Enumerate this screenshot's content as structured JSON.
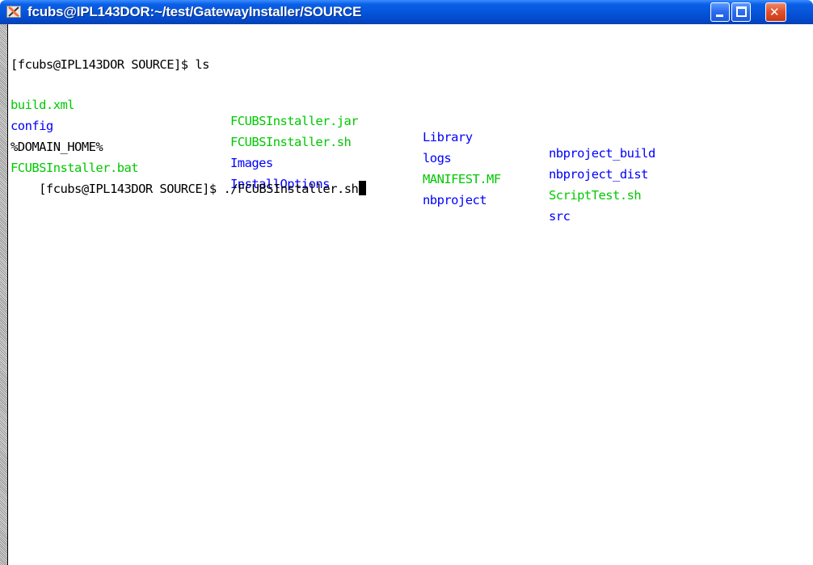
{
  "window": {
    "title": "fcubs@IPL143DOR:~/test/GatewayInstaller/SOURCE",
    "icons": {
      "app": "xterm-x-icon",
      "minimize": "minimize-icon",
      "maximize": "maximize-icon",
      "close": "close-icon"
    },
    "colors": {
      "titlebar": "#0554d8",
      "close": "#e0542e"
    }
  },
  "terminal": {
    "colors": {
      "text": "#000000",
      "file_green": "#00c800",
      "dir_blue": "#0000ff",
      "background": "#ffffff"
    },
    "prompt1": "[fcubs@IPL143DOR SOURCE]$ ls",
    "listing": [
      [
        "build.xml",
        "FCUBSInstaller.jar",
        "Library",
        "nbproject_build"
      ],
      [
        "config",
        "FCUBSInstaller.sh",
        "logs",
        "nbproject_dist"
      ],
      [
        "%DOMAIN_HOME%",
        "Images",
        "MANIFEST.MF",
        "ScriptTest.sh"
      ],
      [
        "FCUBSInstaller.bat",
        "InstallOptions",
        "nbproject",
        "src"
      ]
    ],
    "prompt2": "[fcubs@IPL143DOR SOURCE]$ ./FCUBSInstaller.sh"
  }
}
